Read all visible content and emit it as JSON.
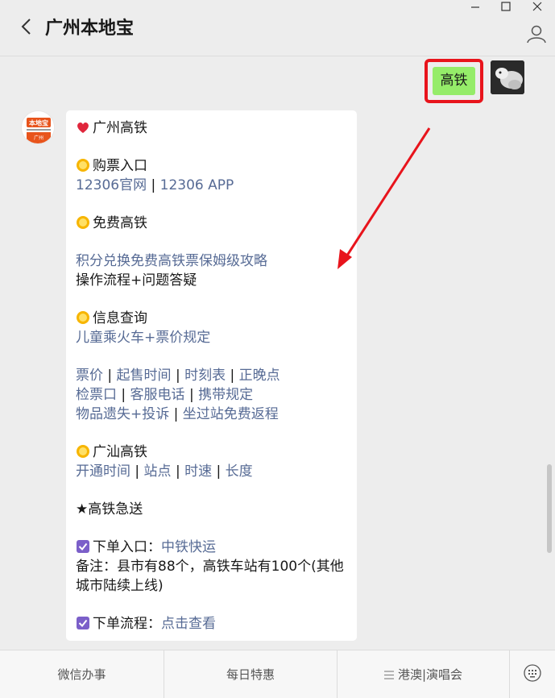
{
  "header": {
    "title": "广州本地宝"
  },
  "my_message": {
    "text": "高铁"
  },
  "bot": {
    "avatar_text_top": "本地宝",
    "avatar_text_bottom": "广州",
    "heading": "广州高铁",
    "ticket": {
      "title": "购票入口",
      "link1": "12306官网",
      "sep": " | ",
      "link2": "12306 APP"
    },
    "free": {
      "title": "免费高铁",
      "link": "积分兑换免费高铁票保姆级攻略",
      "text": "操作流程+问题答疑"
    },
    "info": {
      "title": "信息查询",
      "link": "儿童乘火车+票价规定"
    },
    "links_row1": [
      "票价",
      "起售时间",
      "时刻表",
      "正晚点"
    ],
    "links_row2": [
      "检票口",
      "客服电话",
      "携带规定"
    ],
    "links_row3": [
      "物品遗失+投诉",
      "坐过站免费返程"
    ],
    "guangshan": {
      "title": "广汕高铁",
      "links": [
        "开通时间",
        "站点",
        "时速",
        "长度"
      ]
    },
    "express": {
      "title": "★高铁急送"
    },
    "order": {
      "label": "下单入口：",
      "link": "中铁快运",
      "note": "备注：县市有88个，高铁车站有100个(其他城市陆续上线)"
    },
    "process": {
      "label": "下单流程：",
      "link": "点击查看"
    }
  },
  "menu": {
    "items": [
      "微信办事",
      "每日特惠",
      "港澳|演唱会"
    ]
  },
  "colors": {
    "link": "#576b95",
    "my_bubble": "#95ec69",
    "highlight_box": "#e8141c",
    "arrow": "#e8141c"
  }
}
